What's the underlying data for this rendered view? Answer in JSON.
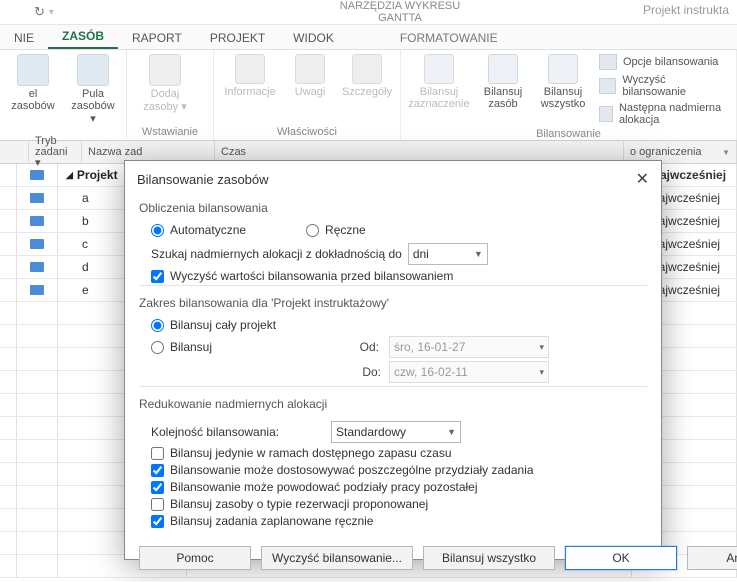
{
  "quickbar": {
    "undo_icon": "↻"
  },
  "context_tab": {
    "title": "NARZĘDZIA WYKRESU GANTTA",
    "format": "FORMATOWANIE"
  },
  "top_right": "Projekt instrukta",
  "tabs": [
    "NIE",
    "ZASÓB",
    "RAPORT",
    "PROJEKT",
    "WIDOK"
  ],
  "active_tab_index": 1,
  "ribbon": {
    "group1": {
      "items": [
        {
          "label": "el\nzasobów"
        },
        {
          "label": "Pula\nzasobów ▾"
        }
      ],
      "label": ""
    },
    "group2": {
      "items": [
        {
          "label": "Dodaj\nzasoby ▾"
        }
      ],
      "label": "Wstawianie"
    },
    "group3": {
      "items": [
        {
          "label": "Informacje"
        },
        {
          "label": "Uwagi"
        },
        {
          "label": "Szczegóły"
        }
      ],
      "label": "Właściwości"
    },
    "group4": {
      "items": [
        {
          "label": "Bilansuj\nzaznaczenie"
        },
        {
          "label": "Bilansuj\nzasób"
        },
        {
          "label": "Bilansuj\nwszystko"
        }
      ],
      "options": [
        "Opcje bilansowania",
        "Wyczyść bilansowanie",
        "Następna nadmierna alokacja"
      ],
      "label": "Bilansowanie"
    }
  },
  "sheet": {
    "headers": {
      "ind": "",
      "mode": "Tryb\nzadani ▾",
      "name": "Nazwa zad",
      "time": "Czas",
      "limit": "o ograniczenia"
    },
    "rows": [
      {
        "name": "Projekt",
        "bold": true,
        "limit": "ak najwcześniej"
      },
      {
        "name": "a",
        "limit": "ak najwcześniej"
      },
      {
        "name": "b",
        "limit": "ak najwcześniej"
      },
      {
        "name": "c",
        "limit": "ak najwcześniej"
      },
      {
        "name": "d",
        "limit": "ak najwcześniej"
      },
      {
        "name": "e",
        "limit": "ak najwcześniej"
      }
    ]
  },
  "dialog": {
    "title": "Bilansowanie zasobów",
    "section1": "Obliczenia bilansowania",
    "radio_auto": "Automatyczne",
    "radio_manual": "Ręczne",
    "lookfor": "Szukaj nadmiernych alokacji z dokładnością do",
    "lookfor_unit": "dni",
    "clear_before": "Wyczyść wartości bilansowania przed bilansowaniem",
    "section2": "Zakres bilansowania dla 'Projekt instruktażowy'",
    "radio_whole": "Bilansuj cały projekt",
    "radio_range": "Bilansuj",
    "od": "Od:",
    "od_val": "śro, 16-01-27",
    "do": "Do:",
    "do_val": "czw, 16-02-11",
    "section3": "Redukowanie nadmiernych alokacji",
    "order_label": "Kolejność bilansowania:",
    "order_val": "Standardowy",
    "chk1": "Bilansuj jedynie w ramach dostępnego zapasu czasu",
    "chk2": "Bilansowanie może dostosowywać poszczególne przydziały zadania",
    "chk3": "Bilansowanie może powodować podziały pracy pozostałej",
    "chk4": "Bilansuj zasoby o typie rezerwacji proponowanej",
    "chk5": "Bilansuj zadania zaplanowane ręcznie",
    "btn_help": "Pomoc",
    "btn_clear": "Wyczyść bilansowanie...",
    "btn_all": "Bilansuj wszystko",
    "btn_ok": "OK",
    "btn_cancel": "Anuluj"
  }
}
